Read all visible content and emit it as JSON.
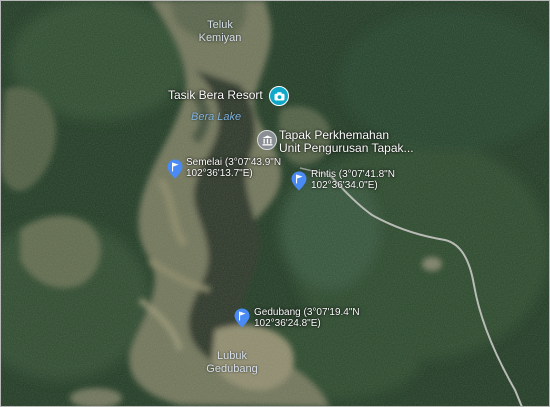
{
  "map": {
    "place_labels": {
      "teluk_kemiyan": [
        "Teluk",
        "Kemiyan"
      ],
      "lubuk_gedubang": [
        "Lubuk",
        "Gedubang"
      ]
    },
    "lake_label": "Bera Lake",
    "pois": {
      "resort": {
        "name": "Tasik Bera Resort",
        "icon": "camera-icon",
        "color": "#0fa8c9"
      },
      "campsite": {
        "name_lines": [
          "Tapak Perkhemahan",
          "Unit Pengurusan Tapak..."
        ],
        "icon": "landmark-icon",
        "color": "#8a8f94"
      }
    },
    "pins": {
      "semelai": [
        "Semelai (3°07'43.9\"N",
        "102°36'13.7\"E)"
      ],
      "rintis": [
        "Rintis (3°07'41.8\"N",
        "102°36'34.0\"E)"
      ],
      "gedubang": [
        "Gedubang (3°07'19.4\"N",
        "102°36'24.8\"E)"
      ]
    },
    "colors": {
      "forest_dark": "#1c3520",
      "forest": "#2c4a2b",
      "wetland": "#6b7357",
      "marsh_tan": "#8d8a6c",
      "water": "#2a3328",
      "road": "#b9bcb6",
      "pin_blue": "#4a8af4"
    }
  }
}
